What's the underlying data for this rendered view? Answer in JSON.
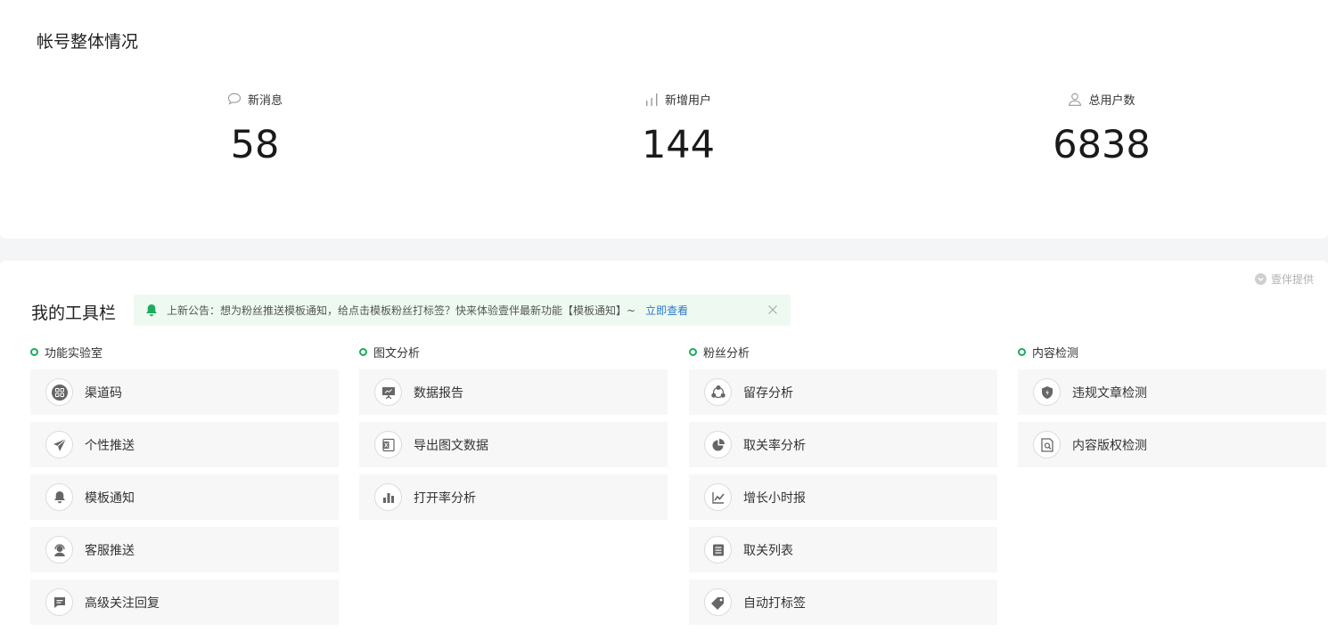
{
  "overview": {
    "title": "帐号整体情况",
    "stats": [
      {
        "label": "新消息",
        "value": "58",
        "icon": "message-icon"
      },
      {
        "label": "新增用户",
        "value": "144",
        "icon": "bar-chart-icon"
      },
      {
        "label": "总用户数",
        "value": "6838",
        "icon": "user-icon"
      }
    ]
  },
  "toolbar": {
    "title": "我的工具栏",
    "provider": "壹伴提供",
    "notice": {
      "text": "上新公告：想为粉丝推送模板通知，给点击模板粉丝打标签？快来体验壹伴最新功能【模板通知】~",
      "link": "立即查看"
    },
    "columns": [
      {
        "title": "功能实验室",
        "items": [
          {
            "label": "渠道码",
            "icon": "qrcode-icon"
          },
          {
            "label": "个性推送",
            "icon": "paper-plane-icon"
          },
          {
            "label": "模板通知",
            "icon": "bell-icon"
          },
          {
            "label": "客服推送",
            "icon": "headset-icon"
          },
          {
            "label": "高级关注回复",
            "icon": "chat-bubble-icon"
          }
        ]
      },
      {
        "title": "图文分析",
        "items": [
          {
            "label": "数据报告",
            "icon": "presentation-icon"
          },
          {
            "label": "导出图文数据",
            "icon": "excel-export-icon"
          },
          {
            "label": "打开率分析",
            "icon": "bar-chart-icon"
          }
        ]
      },
      {
        "title": "粉丝分析",
        "items": [
          {
            "label": "留存分析",
            "icon": "network-icon"
          },
          {
            "label": "取关率分析",
            "icon": "pie-chart-icon"
          },
          {
            "label": "增长小时报",
            "icon": "line-chart-icon"
          },
          {
            "label": "取关列表",
            "icon": "list-icon"
          },
          {
            "label": "自动打标签",
            "icon": "tag-icon"
          }
        ]
      },
      {
        "title": "内容检测",
        "items": [
          {
            "label": "违规文章检测",
            "icon": "shield-icon"
          },
          {
            "label": "内容版权检测",
            "icon": "document-search-icon"
          }
        ]
      }
    ]
  },
  "colors": {
    "accent": "#1aad5e",
    "link": "#2a78c9",
    "noticeBg": "#eefaf1",
    "itemBg": "#f7f7f7"
  }
}
